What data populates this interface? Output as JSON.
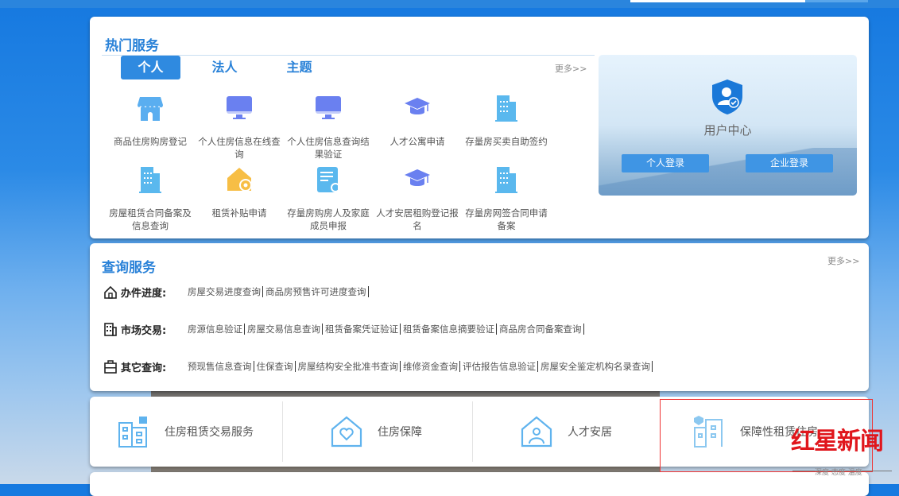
{
  "hot": {
    "title": "热门服务",
    "tabs": [
      "个人",
      "法人",
      "主题"
    ],
    "more": "更多>>",
    "services": [
      "商品住房购房登记",
      "个人住房信息在线查询",
      "个人住房信息查询结果验证",
      "人才公寓申请",
      "存量房买卖自助签约",
      "房屋租赁合同备案及信息查询",
      "租赁补贴申请",
      "存量房购房人及家庭成员申报",
      "人才安居租购登记报名",
      "存量房网签合同申请备案"
    ]
  },
  "user_center": {
    "title": "用户中心",
    "personal_login": "个人登录",
    "enterprise_login": "企业登录"
  },
  "query": {
    "title": "查询服务",
    "more": "更多>>",
    "rows": [
      {
        "label": "办件进度:",
        "links": [
          "房屋交易进度查询",
          "商品房预售许可进度查询"
        ]
      },
      {
        "label": "市场交易:",
        "links": [
          "房源信息验证",
          "房屋交易信息查询",
          "租赁备案凭证验证",
          "租赁备案信息摘要验证",
          "商品房合同备案查询"
        ]
      },
      {
        "label": "其它查询:",
        "links": [
          "预现售信息查询",
          "住保查询",
          "房屋结构安全批准书查询",
          "维修资金查询",
          "评估报告信息验证",
          "房屋安全鉴定机构名录查询"
        ]
      }
    ]
  },
  "bottom": [
    "住房租赁交易服务",
    "住房保障",
    "人才安居",
    "保障性租赁住房"
  ],
  "watermark": {
    "logo": "红星新闻",
    "tagline": "深度 态度 温度"
  },
  "colors": {
    "accent": "#2a82d8",
    "highlight_box": "#e33333"
  }
}
